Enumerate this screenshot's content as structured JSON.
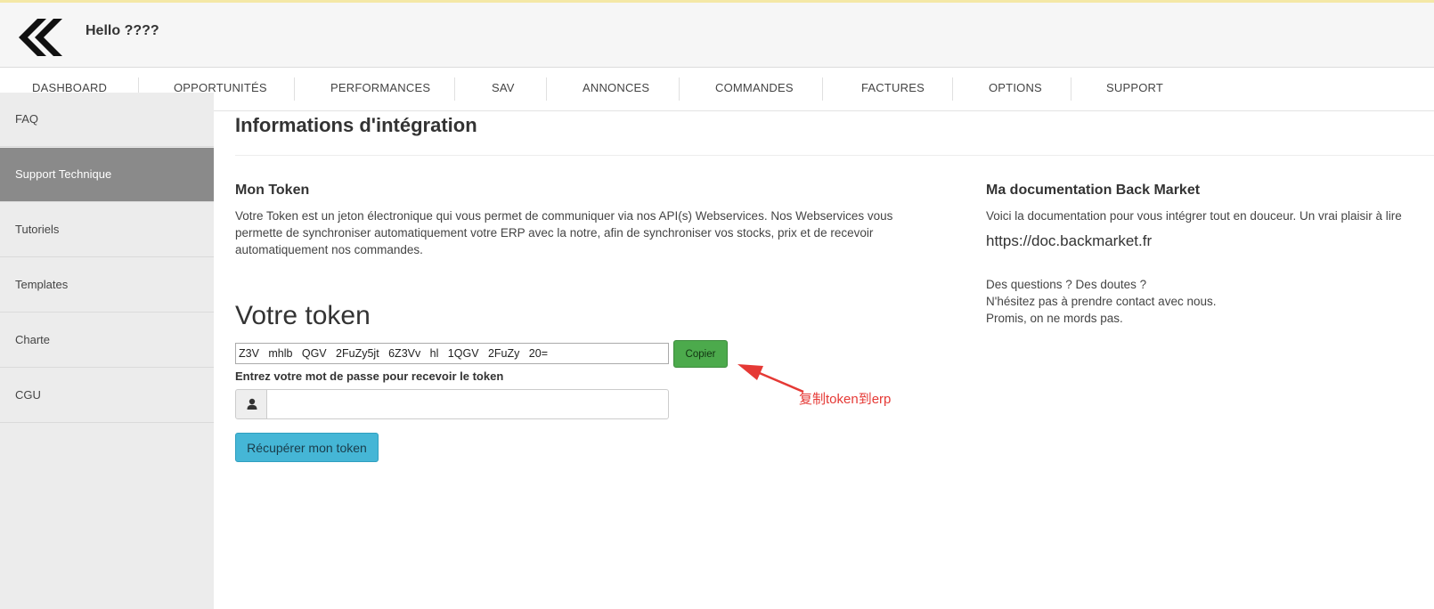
{
  "header": {
    "greeting": "Hello ????"
  },
  "nav": {
    "items": [
      "DASHBOARD",
      "OPPORTUNITÉS",
      "PERFORMANCES",
      "SAV",
      "ANNONCES",
      "COMMANDES",
      "FACTURES",
      "OPTIONS",
      "SUPPORT"
    ]
  },
  "sidebar": {
    "items": [
      {
        "label": "FAQ"
      },
      {
        "label": "Support Technique",
        "active": true
      },
      {
        "label": "Tutoriels"
      },
      {
        "label": "Templates"
      },
      {
        "label": "Charte"
      },
      {
        "label": "CGU"
      }
    ]
  },
  "main": {
    "title": "Informations d'intégration",
    "token_section": {
      "heading": "Mon Token",
      "description_lines": [
        "Votre Token est un jeton électronique qui vous permet de communiquer via nos API(s) Webservices. Nos Webservices vous",
        "permette de synchroniser automatiquement votre ERP avec la notre, afin de synchroniser vos stocks, prix et de recevoir",
        "automatiquement nos commandes."
      ],
      "token_title": "Votre token",
      "token_value": "Z3V   mhlb   QGV   2FuZy5jt   6Z3Vv   hl   1QGV   2FuZy   20=",
      "copy_label": "Copier",
      "password_label": "Entrez votre mot de passe pour recevoir le token",
      "password_value": "",
      "fetch_label": "Récupérer mon token",
      "lock_icon": "user-icon"
    },
    "doc_section": {
      "heading": "Ma documentation Back Market",
      "intro": "Voici la documentation pour vous intégrer tout en douceur. Un vrai plaisir à lire",
      "link": "https://doc.backmarket.fr",
      "questions_lines": [
        "Des questions ? Des doutes ?",
        "N'hésitez pas à prendre contact avec nous.",
        "Promis, on ne mords pas."
      ]
    }
  },
  "annotation": {
    "text": "复制token到erp",
    "color": "#e53935"
  }
}
